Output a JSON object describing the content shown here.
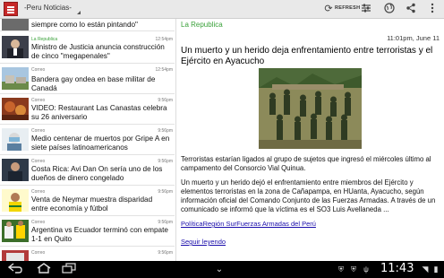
{
  "app": {
    "title": "-Peru Noticias-",
    "refresh_label": "REFRESH",
    "accent_color": "#3aa13a",
    "icons": [
      "refresh-icon",
      "filter-icon",
      "globe-icon",
      "share-icon",
      "overflow-menu-icon"
    ]
  },
  "list": {
    "items": [
      {
        "source": "",
        "time": "",
        "title": "siempre como lo están pintando\""
      },
      {
        "source": "La Republica",
        "time": "12:54pm",
        "title": "Ministro de Justicia anuncia construcción de cinco \"megapenales\""
      },
      {
        "source": "Correo",
        "time": "12:54pm",
        "title": "Bandera gay ondea en base militar de Canadá"
      },
      {
        "source": "Correo",
        "time": "9:56pm",
        "title": "VIDEO: Restaurant Las Canastas celebra su 26 aniversario"
      },
      {
        "source": "Correo",
        "time": "9:56pm",
        "title": "Medio centenar de muertos por Gripe A en siete países latinoamericanos"
      },
      {
        "source": "Correo",
        "time": "9:56pm",
        "title": "Costa Rica: Avi Dan On sería uno de los dueños de dinero congelado"
      },
      {
        "source": "Correo",
        "time": "9:56pm",
        "title": "Venta de Neymar muestra disparidad entre economía y fútbol"
      },
      {
        "source": "Correo",
        "time": "9:56pm",
        "title": "Argentina vs Ecuador terminó con empate 1-1 en Quito"
      },
      {
        "source": "Correo",
        "time": "9:56pm",
        "title": ""
      }
    ]
  },
  "article": {
    "source": "La Republica",
    "time": "11:01pm, June 11",
    "title": "Un muerto y un herido deja enfrentamiento entre terroristas y el Ejército en Ayacucho",
    "paragraph1": "Terroristas estarían ligados al grupo de sujetos que ingresó el miércoles último al campamento del Consorcio Vial Quinua.",
    "paragraph2": "Un muerto y un herido dejó el enfrentamiento entre miembros del Ejército y elementos terroristas en la zona de Cañapampa, en HUanta, Ayacucho, según información oficial del Comando Conjunto de las Fuerzas Armadas. A través de un comunicado se informó que la víctima es el SO3 Luis Avellaneda ...",
    "tags": "PolíticaRegión SurFuerzas Armadas del Perú",
    "read_more": "Seguir leyendo"
  },
  "system": {
    "clock": "11:43"
  }
}
